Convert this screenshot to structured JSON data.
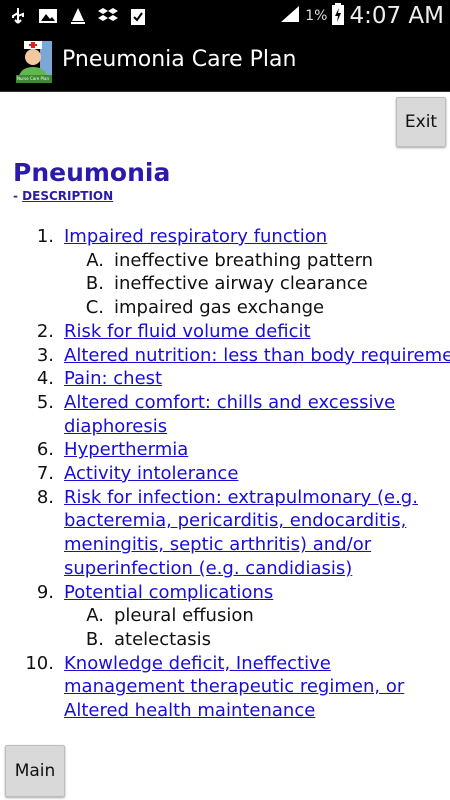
{
  "status_bar": {
    "battery_percent": "1%",
    "time": "4:07 AM",
    "icons": [
      "usb-icon",
      "image-icon",
      "sailboat-icon",
      "dropbox-icon",
      "clipboard-check-icon",
      "signal-icon",
      "battery-charging-icon"
    ]
  },
  "action_bar": {
    "title": "Pneumonia Care Plan",
    "icon_text": "Nurse Care Plan"
  },
  "buttons": {
    "exit": "Exit",
    "main": "Main"
  },
  "page": {
    "title": "Pneumonia",
    "desc_prefix": "- ",
    "desc_link": "DESCRIPTION"
  },
  "items": [
    {
      "num": "1.",
      "text": "Impaired respiratory function",
      "subs": [
        {
          "letter": "A.",
          "text": "ineffective breathing pattern"
        },
        {
          "letter": "B.",
          "text": "ineffective airway clearance"
        },
        {
          "letter": "C.",
          "text": "impaired gas exchange"
        }
      ]
    },
    {
      "num": "2.",
      "text": "Risk for fluid volume deficit"
    },
    {
      "num": "3.",
      "text": "Altered nutrition: less than body requiremer"
    },
    {
      "num": "4.",
      "text": "Pain: chest"
    },
    {
      "num": "5.",
      "text": "Altered comfort: chills and excessive diaphoresis"
    },
    {
      "num": "6.",
      "text": "Hyperthermia"
    },
    {
      "num": "7.",
      "text": "Activity intolerance"
    },
    {
      "num": "8.",
      "text": "Risk for infection: extrapulmonary (e.g. bacteremia, pericarditis, endocarditis, meningitis, septic arthritis) and/or superinfection (e.g. candidiasis)"
    },
    {
      "num": "9.",
      "text": "Potential complications",
      "subs": [
        {
          "letter": "A.",
          "text": "pleural effusion"
        },
        {
          "letter": "B.",
          "text": "atelectasis"
        }
      ]
    },
    {
      "num": "10.",
      "text": "Knowledge deficit, Ineffective management therapeutic regimen, or Altered health maintenance"
    }
  ],
  "colors": {
    "link": "#1a0dd6",
    "title": "#2c1aa8",
    "bar": "#000000"
  }
}
